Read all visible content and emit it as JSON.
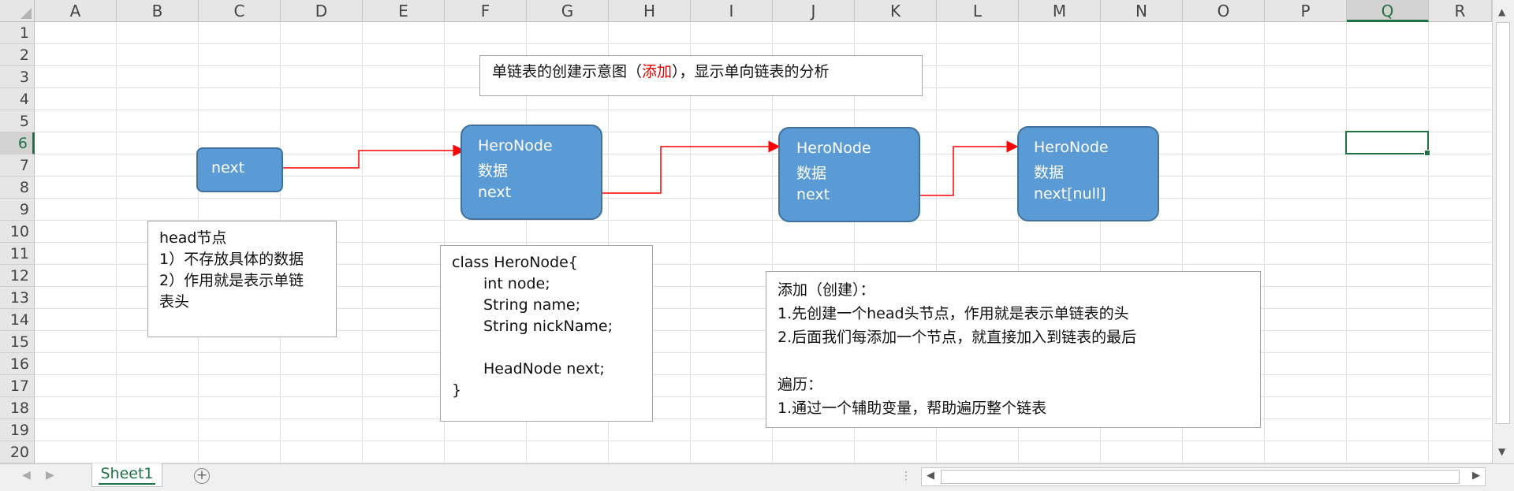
{
  "columns": [
    "A",
    "B",
    "C",
    "D",
    "E",
    "F",
    "G",
    "H",
    "I",
    "J",
    "K",
    "L",
    "M",
    "N",
    "O",
    "P",
    "Q",
    "R"
  ],
  "rows": [
    "1",
    "2",
    "3",
    "4",
    "5",
    "6",
    "7",
    "8",
    "9",
    "10",
    "11",
    "12",
    "13",
    "14",
    "15",
    "16",
    "17",
    "18",
    "19",
    "20"
  ],
  "selected_column": "Q",
  "selected_row": "6",
  "title_box": {
    "prefix": "单链表的创建示意图（",
    "highlight": "添加",
    "suffix": "），显示单向链表的分析"
  },
  "head_node": {
    "label": "next"
  },
  "nodes": [
    {
      "name": "HeroNode",
      "data": "数据",
      "next": "next"
    },
    {
      "name": "HeroNode",
      "data": "数据",
      "next": "next"
    },
    {
      "name": "HeroNode",
      "data": "数据",
      "next": "next[null]"
    }
  ],
  "head_note": {
    "lines": [
      "head节点",
      "1）不存放具体的数据",
      "2）作用就是表示单链",
      "表头"
    ]
  },
  "class_box": {
    "lines": [
      "class HeroNode{",
      "int node;",
      "String name;",
      "String nickName;",
      "",
      "HeadNode next;",
      "}"
    ]
  },
  "steps_box": {
    "lines": [
      "添加（创建）：",
      "1.先创建一个head头节点，作用就是表示单链表的头",
      "2.后面我们每添加一个节点，就直接加入到链表的最后",
      "",
      "遍历：",
      "1.通过一个辅助变量，帮助遍历整个链表"
    ]
  },
  "sheet_tab": {
    "label": "Sheet1"
  },
  "colors": {
    "node_fill": "#5b9bd5",
    "arrow": "#ff0000",
    "accent": "#217346",
    "highlight_text": "#e00000"
  }
}
